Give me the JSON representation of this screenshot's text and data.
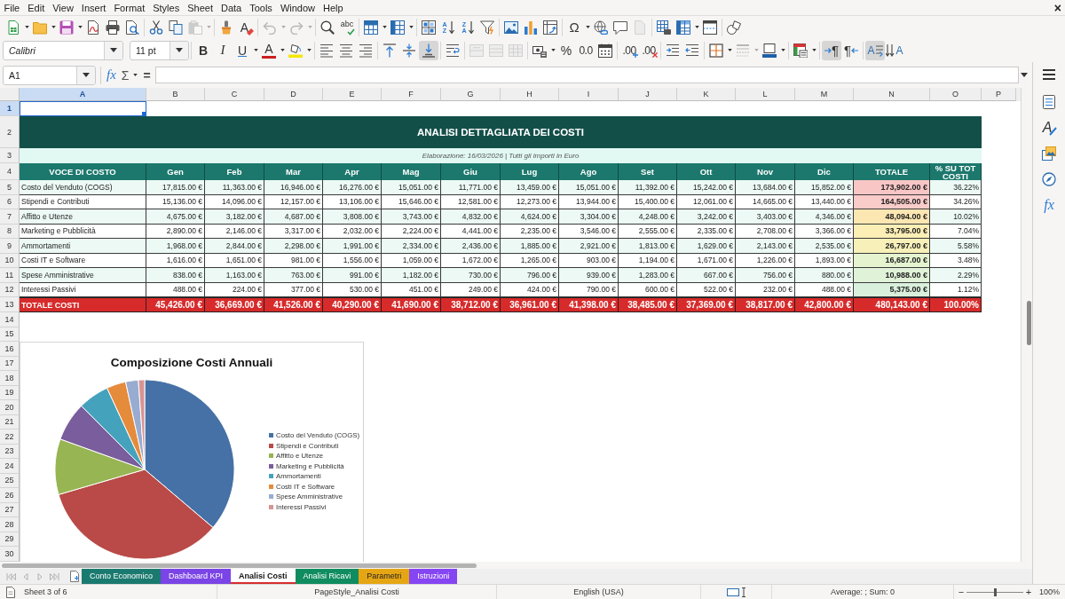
{
  "menu_bar": {
    "items": [
      "File",
      "Edit",
      "View",
      "Insert",
      "Format",
      "Styles",
      "Sheet",
      "Data",
      "Tools",
      "Window",
      "Help"
    ],
    "close": "×"
  },
  "standard_toolbar": [
    [
      {
        "kind": "new",
        "disabled": false
      },
      {
        "kind": "open",
        "disabled": false
      },
      {
        "kind": "save",
        "disabled": false
      },
      {
        "kind": "pdf",
        "disabled": false
      },
      {
        "kind": "print",
        "disabled": false
      },
      {
        "kind": "preview",
        "disabled": false
      }
    ],
    [
      {
        "kind": "cut",
        "disabled": false
      },
      {
        "kind": "copy",
        "disabled": false
      },
      {
        "kind": "paste",
        "disabled": true
      }
    ],
    [
      {
        "kind": "clone",
        "disabled": false
      },
      {
        "kind": "clear",
        "glyph": "A",
        "disabled": false
      }
    ],
    [
      {
        "kind": "undo",
        "disabled": true
      },
      {
        "kind": "redo",
        "disabled": true
      }
    ],
    [
      {
        "kind": "find",
        "disabled": false
      },
      {
        "kind": "spell",
        "glyph": "abc",
        "disabled": false
      }
    ],
    [
      {
        "kind": "rows",
        "disabled": false
      },
      {
        "kind": "columns",
        "disabled": false
      }
    ],
    [
      {
        "kind": "sort",
        "disabled": false
      },
      {
        "kind": "sortasc",
        "glyph": "AZ",
        "disabled": false
      },
      {
        "kind": "sortdesc",
        "glyph": "ZA",
        "disabled": false
      },
      {
        "kind": "filter",
        "disabled": false
      }
    ],
    [
      {
        "kind": "image",
        "disabled": false
      },
      {
        "kind": "chart",
        "disabled": false
      },
      {
        "kind": "pivot",
        "disabled": false
      }
    ],
    [
      {
        "kind": "special",
        "glyph": "Ω",
        "disabled": false
      },
      {
        "kind": "link",
        "disabled": false
      },
      {
        "kind": "comment",
        "disabled": false
      },
      {
        "kind": "headerfooter",
        "disabled": true
      }
    ],
    [
      {
        "kind": "printarea",
        "disabled": false
      },
      {
        "kind": "freeze",
        "disabled": false
      },
      {
        "kind": "split",
        "disabled": false
      }
    ],
    [
      {
        "kind": "draw",
        "disabled": false
      }
    ]
  ],
  "formatting_toolbar": {
    "font_name": "Calibri",
    "font_size": "11 pt",
    "groups": [
      [
        {
          "kind": "bold",
          "glyph": "B",
          "disabled": false,
          "pressed": false
        },
        {
          "kind": "italic",
          "glyph": "I",
          "disabled": false,
          "pressed": false
        },
        {
          "kind": "underline",
          "glyph": "U",
          "disabled": false,
          "pressed": false
        },
        {
          "kind": "fontcolor",
          "glyph": "A",
          "disabled": false,
          "pressed": false
        },
        {
          "kind": "highlight",
          "disabled": false,
          "pressed": false
        }
      ],
      [
        {
          "kind": "alignleft",
          "disabled": false,
          "pressed": false
        },
        {
          "kind": "aligncenter",
          "disabled": false,
          "pressed": false
        },
        {
          "kind": "alignright",
          "disabled": false,
          "pressed": false
        }
      ],
      [
        {
          "kind": "aligntop",
          "disabled": false,
          "pressed": false
        },
        {
          "kind": "alignmiddle",
          "disabled": false,
          "pressed": false
        },
        {
          "kind": "alignbottom",
          "disabled": false,
          "pressed": true
        }
      ],
      [
        {
          "kind": "wrap",
          "disabled": false,
          "pressed": false
        }
      ],
      [
        {
          "kind": "mergecenter",
          "disabled": true,
          "pressed": false
        },
        {
          "kind": "merge",
          "disabled": true,
          "pressed": false
        },
        {
          "kind": "unmerge",
          "disabled": true,
          "pressed": false
        }
      ],
      [
        {
          "kind": "currency",
          "disabled": false,
          "pressed": false
        },
        {
          "kind": "percent",
          "glyph": "%",
          "disabled": false,
          "pressed": false
        },
        {
          "kind": "number",
          "glyph": "0.0",
          "disabled": false,
          "pressed": false
        },
        {
          "kind": "date",
          "disabled": false,
          "pressed": false
        }
      ],
      [
        {
          "kind": "adddecimal",
          "glyph": ".00",
          "disabled": false,
          "pressed": false
        },
        {
          "kind": "deletedecimal",
          "glyph": ".00",
          "disabled": false,
          "pressed": false
        }
      ],
      [
        {
          "kind": "indent",
          "disabled": false,
          "pressed": false
        },
        {
          "kind": "outdent",
          "disabled": false,
          "pressed": false
        }
      ],
      [
        {
          "kind": "borders",
          "disabled": false,
          "pressed": false
        },
        {
          "kind": "borderstyle",
          "disabled": true,
          "pressed": false
        },
        {
          "kind": "bordercolor",
          "disabled": false,
          "pressed": false
        }
      ],
      [
        {
          "kind": "conditional",
          "disabled": false,
          "pressed": false
        }
      ],
      [
        {
          "kind": "ltr",
          "glyph": "¶",
          "disabled": false,
          "pressed": true
        },
        {
          "kind": "rtl",
          "glyph": "¶",
          "disabled": false,
          "pressed": false
        }
      ],
      [
        {
          "kind": "textlr",
          "glyph": "A",
          "disabled": false,
          "pressed": true
        },
        {
          "kind": "texttb",
          "glyph": "A",
          "disabled": false,
          "pressed": false
        }
      ]
    ]
  },
  "formula_bar": {
    "name_box": "A1",
    "function_wizard": "fx",
    "sum": "Σ",
    "function": "="
  },
  "sidebar": [
    {
      "kind": "menu"
    },
    {
      "kind": "properties"
    },
    {
      "kind": "styles",
      "glyph": "A"
    },
    {
      "kind": "gallery"
    },
    {
      "kind": "navigator"
    },
    {
      "kind": "functions",
      "glyph": "fx"
    }
  ],
  "columns": [
    {
      "label": "A",
      "selected": true
    },
    {
      "label": "B",
      "selected": false
    },
    {
      "label": "C",
      "selected": false
    },
    {
      "label": "D",
      "selected": false
    },
    {
      "label": "E",
      "selected": false
    },
    {
      "label": "F",
      "selected": false
    },
    {
      "label": "G",
      "selected": false
    },
    {
      "label": "H",
      "selected": false
    },
    {
      "label": "I",
      "selected": false
    },
    {
      "label": "J",
      "selected": false
    },
    {
      "label": "K",
      "selected": false
    },
    {
      "label": "L",
      "selected": false
    },
    {
      "label": "M",
      "selected": false
    },
    {
      "label": "N",
      "selected": false
    },
    {
      "label": "O",
      "selected": false
    },
    {
      "label": "P",
      "selected": false
    }
  ],
  "row_headers": [
    {
      "label": "1",
      "selected": true
    },
    {
      "label": "2",
      "selected": false
    },
    {
      "label": "3",
      "selected": false
    },
    {
      "label": "4",
      "selected": false
    },
    {
      "label": "5",
      "selected": false
    },
    {
      "label": "6",
      "selected": false
    },
    {
      "label": "7",
      "selected": false
    },
    {
      "label": "8",
      "selected": false
    },
    {
      "label": "9",
      "selected": false
    },
    {
      "label": "10",
      "selected": false
    },
    {
      "label": "11",
      "selected": false
    },
    {
      "label": "12",
      "selected": false
    },
    {
      "label": "13",
      "selected": false
    },
    {
      "label": "14",
      "selected": false
    },
    {
      "label": "15",
      "selected": false
    },
    {
      "label": "16",
      "selected": false
    },
    {
      "label": "17",
      "selected": false
    },
    {
      "label": "18",
      "selected": false
    },
    {
      "label": "19",
      "selected": false
    },
    {
      "label": "20",
      "selected": false
    },
    {
      "label": "21",
      "selected": false
    },
    {
      "label": "22",
      "selected": false
    },
    {
      "label": "23",
      "selected": false
    },
    {
      "label": "24",
      "selected": false
    },
    {
      "label": "25",
      "selected": false
    },
    {
      "label": "26",
      "selected": false
    },
    {
      "label": "27",
      "selected": false
    },
    {
      "label": "28",
      "selected": false
    },
    {
      "label": "29",
      "selected": false
    },
    {
      "label": "30",
      "selected": false
    }
  ],
  "report": {
    "title": "ANALISI DETTAGLIATA DEI COSTI",
    "subtitle": "Elaborazione: 16/03/2026 | Tutti gli importi in Euro",
    "headers": [
      "VOCE DI COSTO",
      "Gen",
      "Feb",
      "Mar",
      "Apr",
      "Mag",
      "Giu",
      "Lug",
      "Ago",
      "Set",
      "Ott",
      "Nov",
      "Dic",
      "TOTALE",
      "% SU TOT COSTI"
    ],
    "rows": [
      {
        "label": "Costo del Venduto (COGS)",
        "months": [
          "17,815.00 €",
          "11,363.00 €",
          "16,946.00 €",
          "16,276.00 €",
          "15,051.00 €",
          "11,771.00 €",
          "13,459.00 €",
          "15,051.00 €",
          "11,392.00 €",
          "15,242.00 €",
          "13,684.00 €",
          "15,852.00 €"
        ],
        "total": {
          "text": "173,902.00 €",
          "color": "#f9c6c6"
        },
        "share": "36.22%"
      },
      {
        "label": "Stipendi e Contributi",
        "months": [
          "15,136.00 €",
          "14,096.00 €",
          "12,157.00 €",
          "13,106.00 €",
          "15,646.00 €",
          "12,581.00 €",
          "12,273.00 €",
          "13,944.00 €",
          "15,400.00 €",
          "12,061.00 €",
          "14,665.00 €",
          "13,440.00 €"
        ],
        "total": {
          "text": "164,505.00 €",
          "color": "#f9cbc9"
        },
        "share": "34.26%"
      },
      {
        "label": "Affitto e Utenze",
        "months": [
          "4,675.00 €",
          "3,182.00 €",
          "4,687.00 €",
          "3,808.00 €",
          "3,743.00 €",
          "4,832.00 €",
          "4,624.00 €",
          "3,304.00 €",
          "4,248.00 €",
          "3,242.00 €",
          "3,403.00 €",
          "4,346.00 €"
        ],
        "total": {
          "text": "48,094.00 €",
          "color": "#fce6b2"
        },
        "share": "10.02%"
      },
      {
        "label": "Marketing e Pubblicità",
        "months": [
          "2,890.00 €",
          "2,146.00 €",
          "3,317.00 €",
          "2,032.00 €",
          "2,224.00 €",
          "4,441.00 €",
          "2,235.00 €",
          "3,546.00 €",
          "2,555.00 €",
          "2,335.00 €",
          "2,708.00 €",
          "3,366.00 €"
        ],
        "total": {
          "text": "33,795.00 €",
          "color": "#fcefb6"
        },
        "share": "7.04%"
      },
      {
        "label": "Ammortamenti",
        "months": [
          "1,968.00 €",
          "2,844.00 €",
          "2,298.00 €",
          "1,991.00 €",
          "2,334.00 €",
          "2,436.00 €",
          "1,885.00 €",
          "2,921.00 €",
          "1,813.00 €",
          "1,629.00 €",
          "2,143.00 €",
          "2,535.00 €"
        ],
        "total": {
          "text": "26,797.00 €",
          "color": "#f7f0b9"
        },
        "share": "5.58%"
      },
      {
        "label": "Costi IT e Software",
        "months": [
          "1,616.00 €",
          "1,651.00 €",
          "981.00 €",
          "1,556.00 €",
          "1,059.00 €",
          "1,672.00 €",
          "1,265.00 €",
          "903.00 €",
          "1,194.00 €",
          "1,671.00 €",
          "1,226.00 €",
          "1,893.00 €"
        ],
        "total": {
          "text": "16,687.00 €",
          "color": "#e5f3cf"
        },
        "share": "3.48%"
      },
      {
        "label": "Spese Amministrative",
        "months": [
          "838.00 €",
          "1,163.00 €",
          "763.00 €",
          "991.00 €",
          "1,182.00 €",
          "730.00 €",
          "796.00 €",
          "939.00 €",
          "1,283.00 €",
          "667.00 €",
          "756.00 €",
          "880.00 €"
        ],
        "total": {
          "text": "10,988.00 €",
          "color": "#e0f2d7"
        },
        "share": "2.29%"
      },
      {
        "label": "Interessi Passivi",
        "months": [
          "488.00 €",
          "224.00 €",
          "377.00 €",
          "530.00 €",
          "451.00 €",
          "249.00 €",
          "424.00 €",
          "790.00 €",
          "600.00 €",
          "522.00 €",
          "232.00 €",
          "488.00 €"
        ],
        "total": {
          "text": "5,375.00 €",
          "color": "#d9f0dc"
        },
        "share": "1.12%"
      }
    ],
    "totals": {
      "label": "TOTALE COSTI",
      "months": [
        "45,426.00 €",
        "36,669.00 €",
        "41,526.00 €",
        "40,290.00 €",
        "41,690.00 €",
        "38,712.00 €",
        "36,961.00 €",
        "41,398.00 €",
        "38,485.00 €",
        "37,369.00 €",
        "38,817.00 €",
        "42,800.00 €"
      ],
      "total": "480,143.00 €",
      "share": "100.00%"
    }
  },
  "chart": {
    "chart_data": {
      "type": "pie",
      "title": "Composizione Costi Annuali",
      "categories": [
        "Costo del Venduto (COGS)",
        "Stipendi e Contributi",
        "Affitto e Utenze",
        "Marketing e Pubblicità",
        "Ammortamenti",
        "Costi IT e Software",
        "Spese Amministrative",
        "Interessi Passivi"
      ],
      "values": [
        36.22,
        34.26,
        10.02,
        7.04,
        5.58,
        3.48,
        2.29,
        1.12
      ],
      "colors": [
        "#4671a6",
        "#b94a47",
        "#97b552",
        "#7a5d9c",
        "#45a2bd",
        "#e58b3c",
        "#98acd2",
        "#d79493"
      ],
      "legend": "right"
    }
  },
  "sheet_navigation": [
    {
      "kind": "first",
      "disabled": true
    },
    {
      "kind": "prev",
      "disabled": true
    },
    {
      "kind": "next",
      "disabled": true
    },
    {
      "kind": "last",
      "disabled": true
    }
  ],
  "sheet_tabs": [
    {
      "label": "Conto Economico",
      "color": "#1b7a6f",
      "selected": false
    },
    {
      "label": "Dashboard KPI",
      "color": "#7b44e6",
      "selected": false
    },
    {
      "label": "Analisi Costi",
      "color": "#d62d2d",
      "selected": true
    },
    {
      "label": "Analisi Ricavi",
      "color": "#0f8c60",
      "selected": false
    },
    {
      "label": "Parametri",
      "color": "#e6a614",
      "selected": false
    },
    {
      "label": "Istruzioni",
      "color": "#8645f2",
      "selected": false
    }
  ],
  "status_bar": {
    "sheet": "Sheet 3 of 6",
    "page_style": "PageStyle_Analisi Costi",
    "language": "English (USA)",
    "summary": "Average: ; Sum: 0",
    "zoom": {
      "out": "−",
      "in": "+",
      "level": 0.5,
      "reading": "100%"
    }
  }
}
